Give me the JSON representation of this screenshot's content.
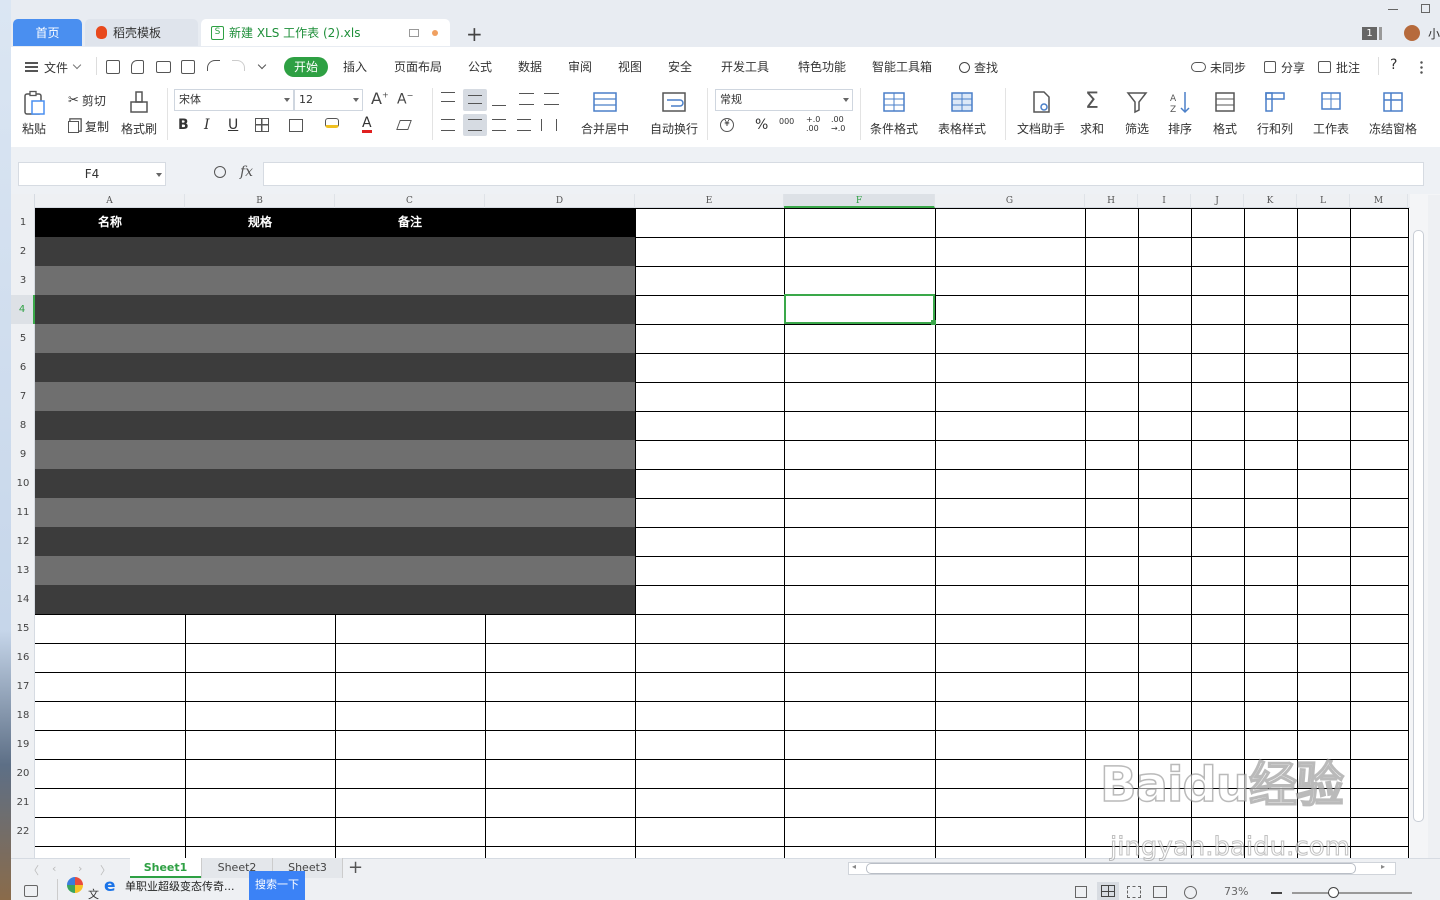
{
  "titlebar": {
    "tab_home": "首页",
    "tab_template": "稻壳模板",
    "tab_doc": "新建 XLS 工作表 (2).xls",
    "new_tab": "+",
    "badge_count": "1",
    "user_initial": "小"
  },
  "menu": {
    "file": "文件",
    "items": [
      "开始",
      "插入",
      "页面布局",
      "公式",
      "数据",
      "审阅",
      "视图",
      "安全",
      "开发工具",
      "特色功能",
      "智能工具箱"
    ],
    "search": "查找",
    "sync": "未同步",
    "share": "分享",
    "comment": "批注",
    "help": "?"
  },
  "ribbon": {
    "paste": "粘贴",
    "cut": "剪切",
    "copy": "复制",
    "format_painter": "格式刷",
    "font_name": "宋体",
    "font_size": "12",
    "bold": "B",
    "italic": "I",
    "underline": "U",
    "merge_center": "合并居中",
    "wrap_text": "自动换行",
    "number_format": "常规",
    "percent": "%",
    "thousands": "000",
    "inc_decimal": "+.0 .00",
    "dec_decimal": ".00 →.0",
    "conditional_format": "条件格式",
    "table_style": "表格样式",
    "doc_assistant": "文档助手",
    "sum": "求和",
    "filter": "筛选",
    "sort": "排序",
    "format": "格式",
    "row_col": "行和列",
    "worksheet": "工作表",
    "freeze": "冻结窗格"
  },
  "formula_bar": {
    "name_box": "F4",
    "fx": "fx",
    "value": ""
  },
  "sheet": {
    "columns": [
      "A",
      "B",
      "C",
      "D",
      "E",
      "F",
      "G",
      "H",
      "I",
      "J",
      "K",
      "L",
      "M"
    ],
    "rows": [
      "1",
      "2",
      "3",
      "4",
      "5",
      "6",
      "7",
      "8",
      "9",
      "10",
      "11",
      "12",
      "13",
      "14",
      "15",
      "16",
      "17",
      "18",
      "19",
      "20",
      "21",
      "22"
    ],
    "header_cells": [
      "名称",
      "规格",
      "备注"
    ],
    "selected_cell": "F4",
    "band_dark": "#3c3c3c",
    "band_light": "#6f6f6f",
    "header_fill": "#000000",
    "selection_color": "#3aa84a"
  },
  "sheet_tabs": [
    "Sheet1",
    "Sheet2",
    "Sheet3"
  ],
  "add_sheet": "+",
  "status": {
    "zoom": "73%",
    "zoom_level": 0.73
  },
  "taskbar": {
    "text_chars": "文",
    "news_text": "单职业超级变态传奇...",
    "search_button": "搜索一下"
  },
  "watermark": {
    "text": "Baidu经验",
    "url": "jingyan.baidu.com"
  }
}
